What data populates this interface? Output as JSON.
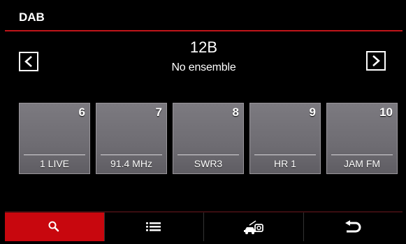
{
  "header": {
    "title": "DAB"
  },
  "channel": {
    "name": "12B",
    "ensemble": "No ensemble"
  },
  "nav": {
    "prev_icon": "chevron-left-icon",
    "next_icon": "chevron-right-icon"
  },
  "presets": [
    {
      "number": "6",
      "name": "1 LIVE"
    },
    {
      "number": "7",
      "name": "91.4 MHz"
    },
    {
      "number": "8",
      "name": "SWR3"
    },
    {
      "number": "9",
      "name": "HR 1"
    },
    {
      "number": "10",
      "name": "JAM FM"
    }
  ],
  "footer": {
    "buttons": [
      {
        "icon": "search-icon",
        "active": true
      },
      {
        "icon": "list-icon",
        "active": false
      },
      {
        "icon": "traffic-announcement-icon",
        "active": false
      },
      {
        "icon": "back-icon",
        "active": false
      }
    ]
  },
  "colors": {
    "accent": "#c8070e",
    "background": "#000000",
    "preset_tile": "#6e6c72"
  }
}
